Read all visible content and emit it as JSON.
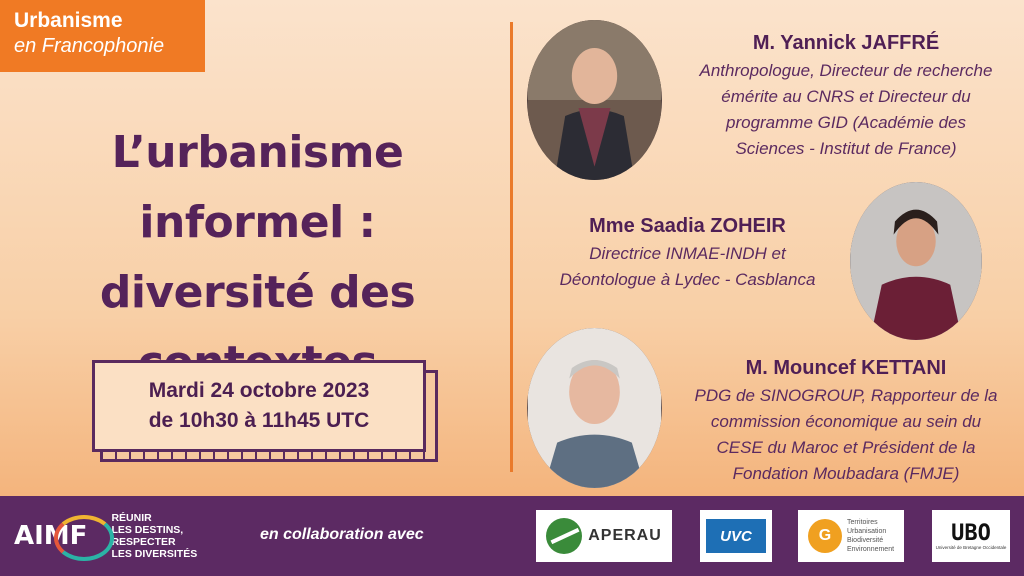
{
  "brand": {
    "line1": "Urbanisme",
    "line2": "en Francophonie"
  },
  "title": {
    "line1": "L’urbanisme informel :",
    "line2": "diversité des",
    "line3": "contextes"
  },
  "date": {
    "line1": "Mardi 24 octobre 2023",
    "line2": "de 10h30 à 11h45 UTC"
  },
  "speakers": [
    {
      "name": "M. Yannick JAFFRÉ",
      "role_lines": [
        "Anthropologue, Directeur de recherche",
        "émérite au CNRS et Directeur du",
        "programme GID (Académie des",
        "Sciences - Institut de France)"
      ]
    },
    {
      "name": "Mme Saadia ZOHEIR",
      "role_lines": [
        "Directrice INMAE-INDH et",
        "Déontologue à Lydec - Casblanca"
      ]
    },
    {
      "name": "M. Mouncef KETTANI",
      "role_lines": [
        "PDG de SINOGROUP, Rapporteur de la",
        "commission économique au sein du",
        "CESE du Maroc et Président de la",
        "Fondation Moubadara (FMJE)"
      ]
    }
  ],
  "footer": {
    "aimf": {
      "logo": "AIMF",
      "tagline": [
        "RÉUNIR",
        "LES DESTINS,",
        "RESPECTER",
        "LES DIVERSITÉS"
      ]
    },
    "collab_text": "en collaboration avec",
    "partners": {
      "aperau": "APERAU",
      "uvc": "UVC",
      "tubr": [
        "Territoires",
        "Urbanisation",
        "Biodiversité",
        "Environnement"
      ],
      "ubo": {
        "logo": "UBO",
        "sub": "Université de Bretagne Occidentale"
      }
    }
  },
  "colors": {
    "accent": "#f07a24",
    "title": "#55235a",
    "footer": "#5c2a63"
  }
}
